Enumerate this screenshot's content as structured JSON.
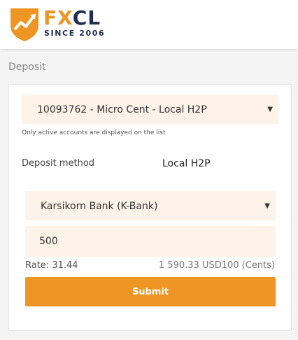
{
  "brand": {
    "name": "FXCL",
    "tagline": "SINCE 2006",
    "colors": {
      "orange": "#ee9523",
      "navy": "#1f2f4f",
      "field_bg": "#fdf3e8"
    }
  },
  "page": {
    "title": "Deposit"
  },
  "form": {
    "account": {
      "value": "10093762 - Micro Cent - Local H2P",
      "hint": "Only active accounts are displayed on the list"
    },
    "deposit_method": {
      "label": "Deposit method",
      "value": "Local H2P"
    },
    "bank": {
      "value": "Karsikorn Bank (K-Bank)"
    },
    "amount": {
      "value": "500"
    },
    "rate": "Rate: 31.44",
    "converted": "1 590.33 USD100 (Cents)",
    "submit_label": "Submit"
  },
  "icons": {
    "select_arrow": "chevron-down-icon"
  }
}
